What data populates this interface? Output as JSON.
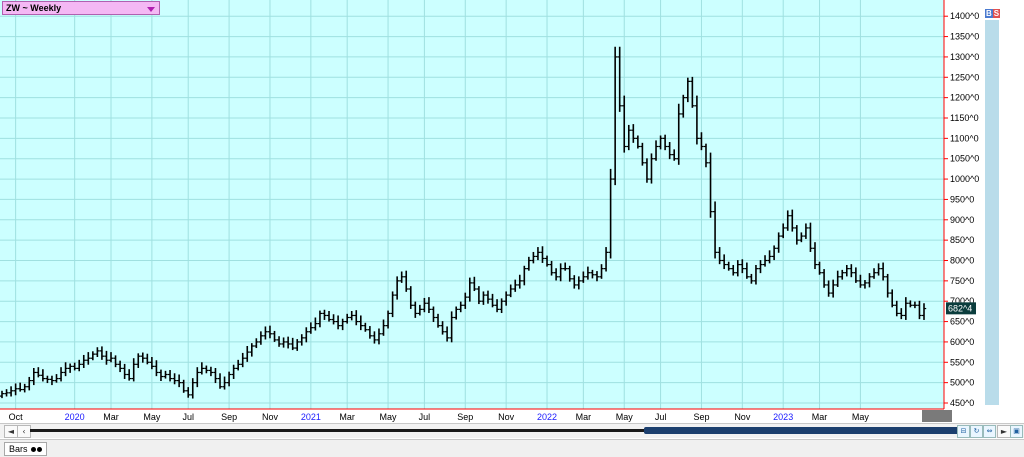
{
  "header": {
    "symbol_label": "ZW ~ Weekly",
    "badge_b": "B",
    "badge_s": "S",
    "last_price": "682^4"
  },
  "footer": {
    "tab_label": "Bars",
    "left_arrow": "◄",
    "right_arrow": "►"
  },
  "colors": {
    "plot_bg": "#ccffff",
    "grid": "#9fe0e0",
    "price_bars": "#000000",
    "axis_line": "#ff0000",
    "price_label_bg": "#0b3d3d",
    "year_label": "#1a1aff"
  },
  "chart_data": {
    "type": "ohlc",
    "title": "ZW ~ Weekly",
    "ylim": [
      450,
      1430
    ],
    "y_ticks": [
      450,
      500,
      550,
      600,
      650,
      700,
      750,
      800,
      850,
      900,
      950,
      1000,
      1050,
      1100,
      1150,
      1200,
      1250,
      1300,
      1350,
      1400
    ],
    "y_tick_labels": [
      "450^0",
      "500^0",
      "550^0",
      "600^0",
      "650^0",
      "700^0",
      "750^0",
      "800^0",
      "850^0",
      "900^0",
      "950^0",
      "1000^0",
      "1050^0",
      "1100^0",
      "1150^0",
      "1200^0",
      "1250^0",
      "1300^0",
      "1350^0",
      "1400^0"
    ],
    "x_labels": [
      {
        "label": "Oct",
        "week": 3,
        "year": false
      },
      {
        "label": "2020",
        "week": 16,
        "year": true
      },
      {
        "label": "Mar",
        "week": 24,
        "year": false
      },
      {
        "label": "May",
        "week": 33,
        "year": false
      },
      {
        "label": "Jul",
        "week": 41,
        "year": false
      },
      {
        "label": "Sep",
        "week": 50,
        "year": false
      },
      {
        "label": "Nov",
        "week": 59,
        "year": false
      },
      {
        "label": "2021",
        "week": 68,
        "year": true
      },
      {
        "label": "Mar",
        "week": 76,
        "year": false
      },
      {
        "label": "May",
        "week": 85,
        "year": false
      },
      {
        "label": "Jul",
        "week": 93,
        "year": false
      },
      {
        "label": "Sep",
        "week": 102,
        "year": false
      },
      {
        "label": "Nov",
        "week": 111,
        "year": false
      },
      {
        "label": "2022",
        "week": 120,
        "year": true
      },
      {
        "label": "Mar",
        "week": 128,
        "year": false
      },
      {
        "label": "May",
        "week": 137,
        "year": false
      },
      {
        "label": "Jul",
        "week": 145,
        "year": false
      },
      {
        "label": "Sep",
        "week": 154,
        "year": false
      },
      {
        "label": "Nov",
        "week": 163,
        "year": false
      },
      {
        "label": "2023",
        "week": 172,
        "year": true
      },
      {
        "label": "Mar",
        "week": 180,
        "year": false
      },
      {
        "label": "May",
        "week": 189,
        "year": false
      }
    ],
    "last_value": 682.5,
    "closes": [
      473,
      475,
      480,
      485,
      483,
      490,
      505,
      525,
      518,
      510,
      508,
      505,
      510,
      525,
      535,
      540,
      535,
      545,
      555,
      560,
      570,
      578,
      565,
      555,
      560,
      545,
      535,
      520,
      510,
      545,
      565,
      560,
      550,
      540,
      525,
      515,
      520,
      510,
      505,
      500,
      480,
      470,
      500,
      525,
      535,
      530,
      525,
      510,
      490,
      500,
      520,
      535,
      545,
      560,
      575,
      590,
      600,
      615,
      625,
      620,
      605,
      595,
      600,
      595,
      585,
      600,
      610,
      625,
      635,
      645,
      670,
      665,
      655,
      650,
      640,
      650,
      660,
      665,
      650,
      640,
      630,
      615,
      605,
      620,
      640,
      670,
      715,
      750,
      760,
      730,
      690,
      670,
      680,
      695,
      680,
      660,
      640,
      625,
      610,
      660,
      680,
      690,
      710,
      745,
      730,
      700,
      715,
      705,
      690,
      680,
      700,
      715,
      730,
      740,
      750,
      780,
      800,
      810,
      820,
      805,
      790,
      770,
      760,
      780,
      780,
      755,
      740,
      750,
      760,
      770,
      765,
      760,
      780,
      820,
      1000,
      1300,
      1180,
      1080,
      1120,
      1100,
      1080,
      1040,
      1000,
      1050,
      1080,
      1100,
      1080,
      1060,
      1050,
      1160,
      1200,
      1240,
      1180,
      1100,
      1080,
      1040,
      920,
      820,
      800,
      790,
      780,
      770,
      790,
      780,
      760,
      750,
      780,
      790,
      800,
      810,
      830,
      860,
      880,
      910,
      880,
      850,
      860,
      880,
      830,
      790,
      770,
      740,
      720,
      740,
      760,
      770,
      780,
      770,
      750,
      740,
      745,
      760,
      770,
      780,
      760,
      720,
      690,
      670,
      665,
      695,
      690,
      690,
      665,
      682
    ]
  }
}
